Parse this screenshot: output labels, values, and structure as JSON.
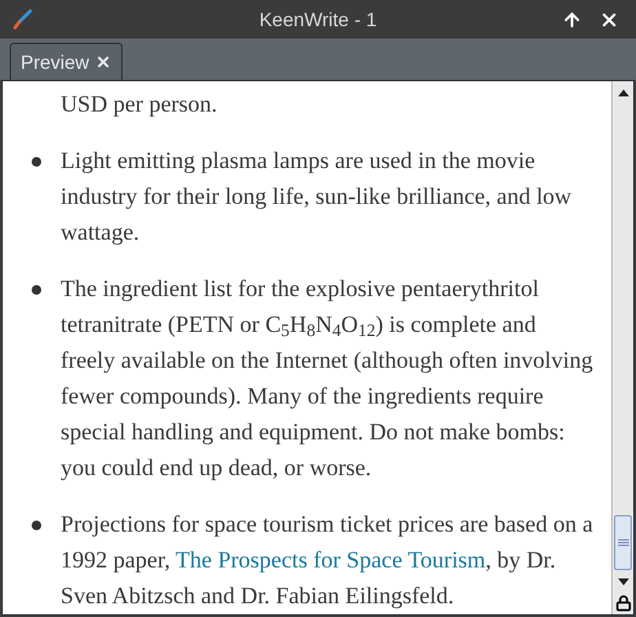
{
  "window": {
    "title": "KeenWrite - 1"
  },
  "tabs": [
    {
      "label": "Preview",
      "selected": true
    }
  ],
  "document": {
    "continuation": "USD per person.",
    "bullets": [
      {
        "kind": "plain",
        "text": "Light emitting plasma lamps are used in the movie industry for their long life, sun-like brilliance, and low wattage."
      },
      {
        "kind": "rich",
        "text": "The ingredient list for the explosive pentaerythritol tetranitrate (PETN or C$_{5}$H$_{8}$N$_{4}$O$_{12}$) is complete and freely available on the Internet (although often involving fewer compounds). Many of the ingredients require special handling and equipment. Do not make bombs: you could end up dead, or worse."
      },
      {
        "kind": "link",
        "before": "Projections for space tourism ticket prices are based on a 1992 paper, ",
        "link": "The Prospects for Space Tourism",
        "after": ", by Dr. Sven Abitzsch and Dr. Fabian Eilingsfeld."
      }
    ]
  }
}
